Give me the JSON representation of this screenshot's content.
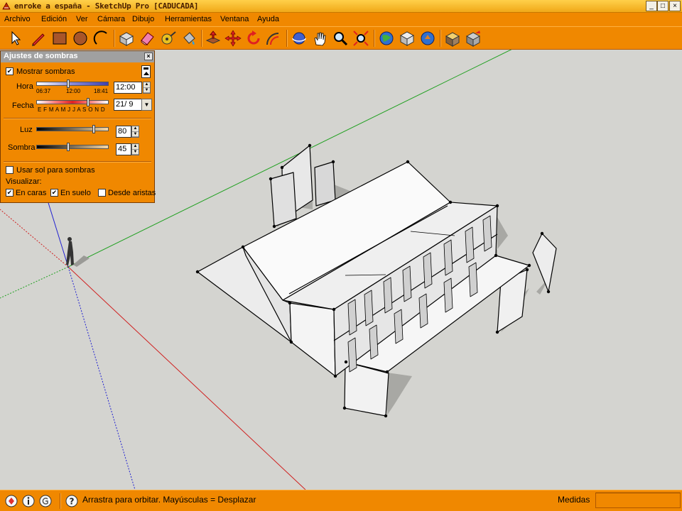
{
  "window": {
    "title": "enroke a españa - SketchUp Pro [CADUCADA]",
    "controls": {
      "minimize": "_",
      "maximize": "□",
      "close": "×"
    }
  },
  "menu": {
    "items": [
      "Archivo",
      "Edición",
      "Ver",
      "Cámara",
      "Dibujo",
      "Herramientas",
      "Ventana",
      "Ayuda"
    ]
  },
  "toolbar": {
    "tools": [
      "select-icon",
      "pencil-icon",
      "rectangle-icon",
      "circle-icon",
      "arc-icon",
      "make-component-icon",
      "eraser-icon",
      "tape-measure-icon",
      "paint-bucket-icon",
      "push-pull-icon",
      "move-icon",
      "rotate-icon",
      "offset-icon",
      "orbit-icon",
      "pan-icon",
      "zoom-icon",
      "zoom-extents-icon",
      "get-models-icon",
      "share-model-icon",
      "share-component-icon",
      "styles-icon",
      "layers-icon"
    ]
  },
  "shadow_panel": {
    "title": "Ajustes de sombras",
    "close": "×",
    "show_shadows": {
      "label": "Mostrar sombras",
      "checked": true
    },
    "time": {
      "label": "Hora",
      "min": "06:37",
      "mid": "12:00",
      "max": "18:41",
      "value": "12:00"
    },
    "date": {
      "label": "Fecha",
      "months": "E F M A M J  J  A S O N D",
      "value": "21/ 9"
    },
    "light": {
      "label": "Luz",
      "value": "80",
      "level": 0.8
    },
    "shade": {
      "label": "Sombra",
      "value": "45",
      "level": 0.45
    },
    "use_sun": {
      "label": "Usar sol para sombras",
      "checked": false
    },
    "display_label": "Visualizar:",
    "on_faces": {
      "label": "En caras",
      "checked": true
    },
    "on_ground": {
      "label": "En suelo",
      "checked": true
    },
    "from_edges": {
      "label": "Desde aristas",
      "checked": false
    }
  },
  "status": {
    "hint": "Arrastra para orbitar. Mayúsculas = Desplazar",
    "measures_label": "Medidas",
    "measures_value": ""
  }
}
